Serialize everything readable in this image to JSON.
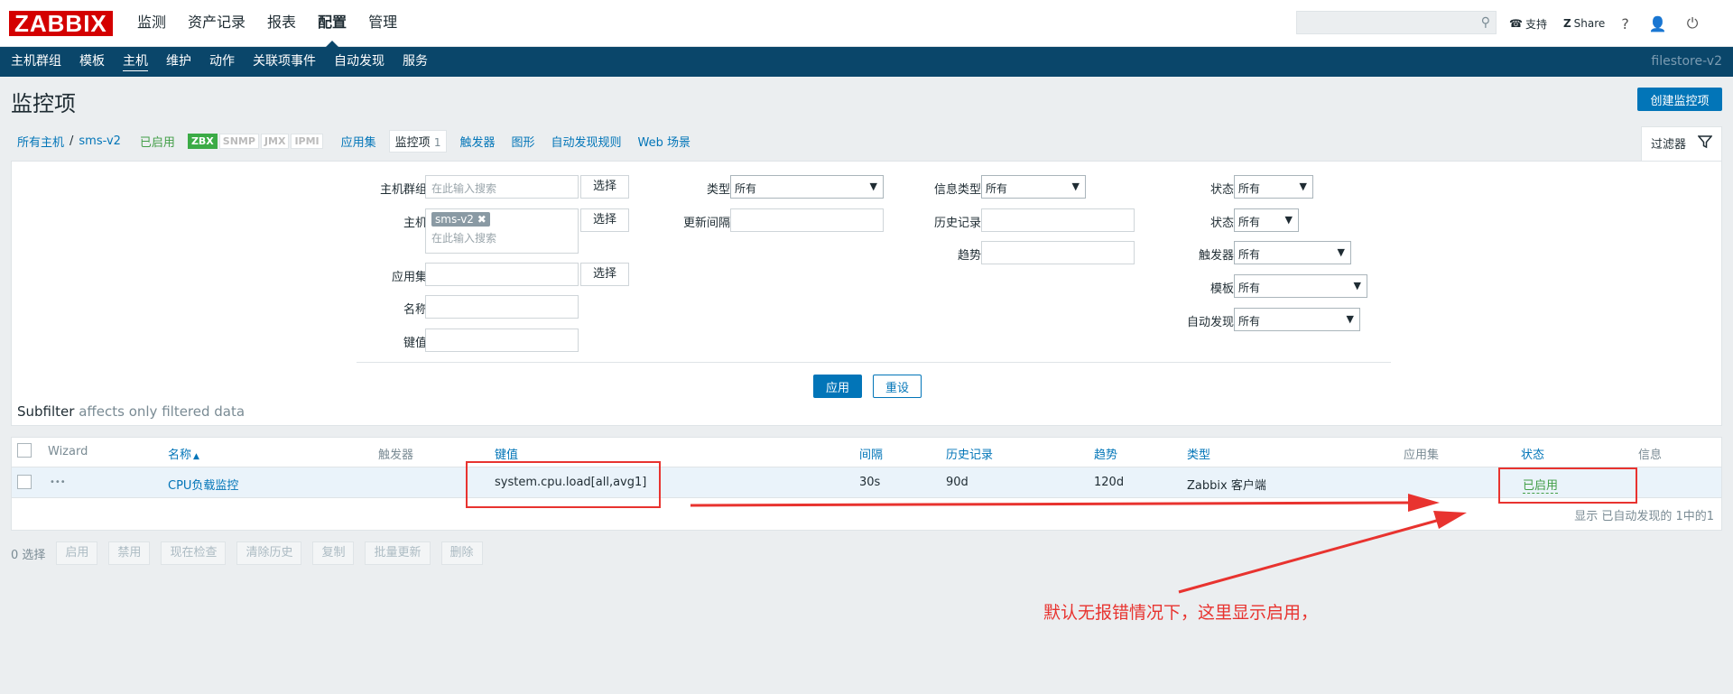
{
  "logo": "ZABBIX",
  "top_nav": [
    "监测",
    "资产记录",
    "报表",
    "配置",
    "管理"
  ],
  "top_nav_active": "配置",
  "top_right": {
    "support": "支持",
    "share": "Share",
    "help": "?"
  },
  "sub_nav": [
    "主机群组",
    "模板",
    "主机",
    "维护",
    "动作",
    "关联项事件",
    "自动发现",
    "服务"
  ],
  "sub_nav_active": "主机",
  "server_name": "filestore-v2",
  "page_title": "监控项",
  "create_button": "创建监控项",
  "breadcrumb": {
    "all_hosts": "所有主机",
    "separator": "/",
    "host": "sms-v2",
    "status": "已启用",
    "tags": [
      "ZBX",
      "SNMP",
      "JMX",
      "IPMI"
    ],
    "applications": "应用集",
    "items_label": "监控项",
    "items_count": "1",
    "triggers": "触发器",
    "graphs": "图形",
    "discovery": "自动发现规则",
    "web": "Web 场景"
  },
  "filter_tab": "过滤器",
  "filter": {
    "host_group_label": "主机群组",
    "host_label": "主机",
    "app_label": "应用集",
    "name_label": "名称",
    "key_label": "键值",
    "placeholder": "在此输入搜索",
    "select_btn": "选择",
    "host_chip": "sms-v2",
    "type_label": "类型",
    "type_value": "所有",
    "interval_label": "更新间隔",
    "info_type_label": "信息类型",
    "info_type_value": "所有",
    "history_label": "历史记录",
    "trends_label": "趋势",
    "state_label": "状态",
    "state_value": "所有",
    "status_label": "状态",
    "status_value": "所有",
    "triggers_label": "触发器",
    "triggers_value": "所有",
    "template_label": "模板",
    "template_value": "所有",
    "discovery_label": "自动发现",
    "discovery_value": "所有",
    "apply": "应用",
    "reset": "重设",
    "subfilter_title": "Subfilter",
    "subfilter_note": "affects only filtered data"
  },
  "table": {
    "headers": {
      "wizard": "Wizard",
      "name": "名称",
      "sort_arrow": "▲",
      "triggers": "触发器",
      "key": "键值",
      "interval": "间隔",
      "history": "历史记录",
      "trends": "趋势",
      "type": "类型",
      "apps": "应用集",
      "status": "状态",
      "info": "信息"
    },
    "row": {
      "dots": "•••",
      "name": "CPU负载监控",
      "key": "system.cpu.load[all,avg1]",
      "interval": "30s",
      "history": "90d",
      "trends": "120d",
      "type": "Zabbix 客户端",
      "status": "已启用"
    },
    "footer": "显示 已自动发现的 1中的1"
  },
  "actions": {
    "selected": "0 选择",
    "buttons": [
      "启用",
      "禁用",
      "现在检查",
      "清除历史",
      "复制",
      "批量更新",
      "删除"
    ]
  },
  "annotation_text": "默认无报错情况下，这里显示启用，",
  "colors": {
    "header_bg": "#0a466a",
    "link": "#0275b8",
    "enabled": "#429e47",
    "annotation": "#e8332f",
    "logo": "#d40000"
  }
}
